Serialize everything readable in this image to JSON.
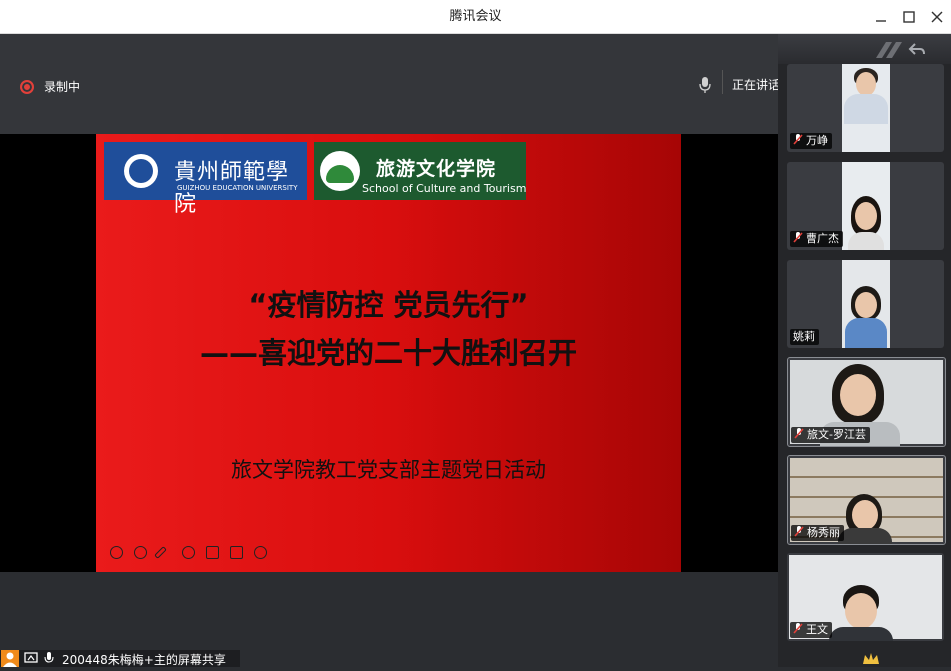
{
  "window": {
    "title": "腾讯会议"
  },
  "toolbar": {
    "recording_label": "录制中",
    "speaking_label": "正在讲话: 韦欣仪; 建国;"
  },
  "slide": {
    "logo_left": {
      "cn": "貴州師範學院",
      "en": "GUIZHOU EDUCATION UNIVERSITY"
    },
    "logo_right": {
      "cn": "旅游文化学院",
      "en": "School of Culture and Tourism"
    },
    "title_line1": "“疫情防控 党员先行”",
    "title_line2": "——喜迎党的二十大胜利召开",
    "subtitle": "旅文学院教工党支部主题党日活动"
  },
  "participants": [
    {
      "name": "万峥",
      "muted": true
    },
    {
      "name": "曹广杰",
      "muted": true
    },
    {
      "name": "姚莉",
      "muted": false
    },
    {
      "name": "旅文-罗江芸",
      "muted": true
    },
    {
      "name": "杨秀丽",
      "muted": true
    },
    {
      "name": "王文",
      "muted": true
    }
  ],
  "share_bar": {
    "label": "200448朱梅梅+主的屏幕共享"
  },
  "colors": {
    "accent_red": "#e2403a",
    "slide_red": "#e01515",
    "mute_red": "#e2403a"
  }
}
